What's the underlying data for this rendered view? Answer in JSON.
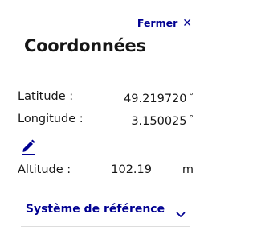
{
  "close": {
    "label": "Fermer",
    "icon": "close-icon"
  },
  "title": "Coordonnées",
  "coordinates": {
    "latitude": {
      "label": "Latitude :",
      "value": "49.219720",
      "unit": "°"
    },
    "longitude": {
      "label": "Longitude :",
      "value": "3.150025",
      "unit": "°"
    },
    "edit_icon": "pencil-icon",
    "altitude": {
      "label": "Altitude :",
      "value": "102.19",
      "unit": "m"
    }
  },
  "reference_system": {
    "label": "Système de référence",
    "icon": "chevron-down-icon"
  },
  "colors": {
    "accent": "#000091",
    "text": "#161616",
    "divider": "#dddddd"
  }
}
